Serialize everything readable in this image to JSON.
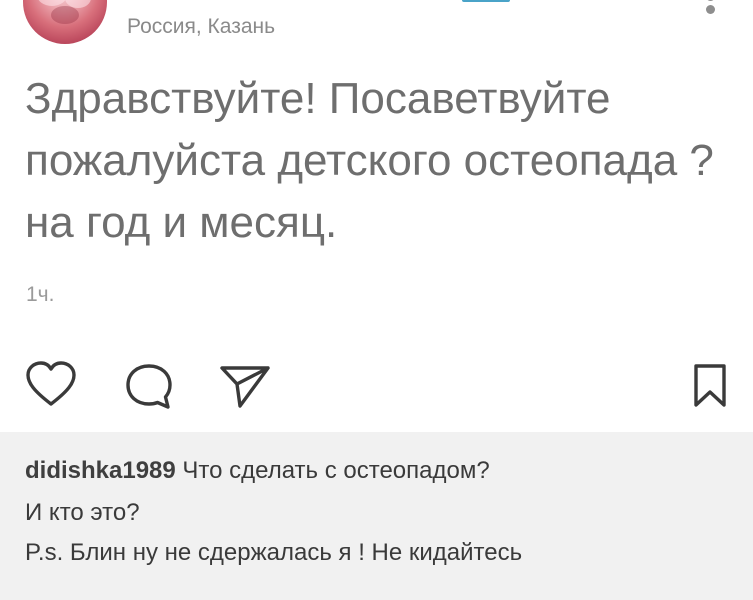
{
  "post": {
    "location": "Россия, Казань",
    "text": "Здравствуйте! Посаветвуйте пожалуйста детского остеопада ?на год и месяц.",
    "timestamp": "1ч."
  },
  "actions": {
    "like_icon": "heart-icon",
    "comment_icon": "comment-bubble-icon",
    "share_icon": "send-icon",
    "save_icon": "bookmark-icon"
  },
  "comments": [
    {
      "author": "didishka1989",
      "text": "Что сделать с остеопадом?",
      "continuation": [
        "И кто это?",
        "P.s. Блин ну не сдержалась я ! Не кидайтесь"
      ]
    }
  ],
  "colors": {
    "text_primary": "#6e6e6e",
    "muted": "#8a8a8a",
    "comment_bg": "#f1f1f1",
    "icon": "#3a3a3a"
  }
}
